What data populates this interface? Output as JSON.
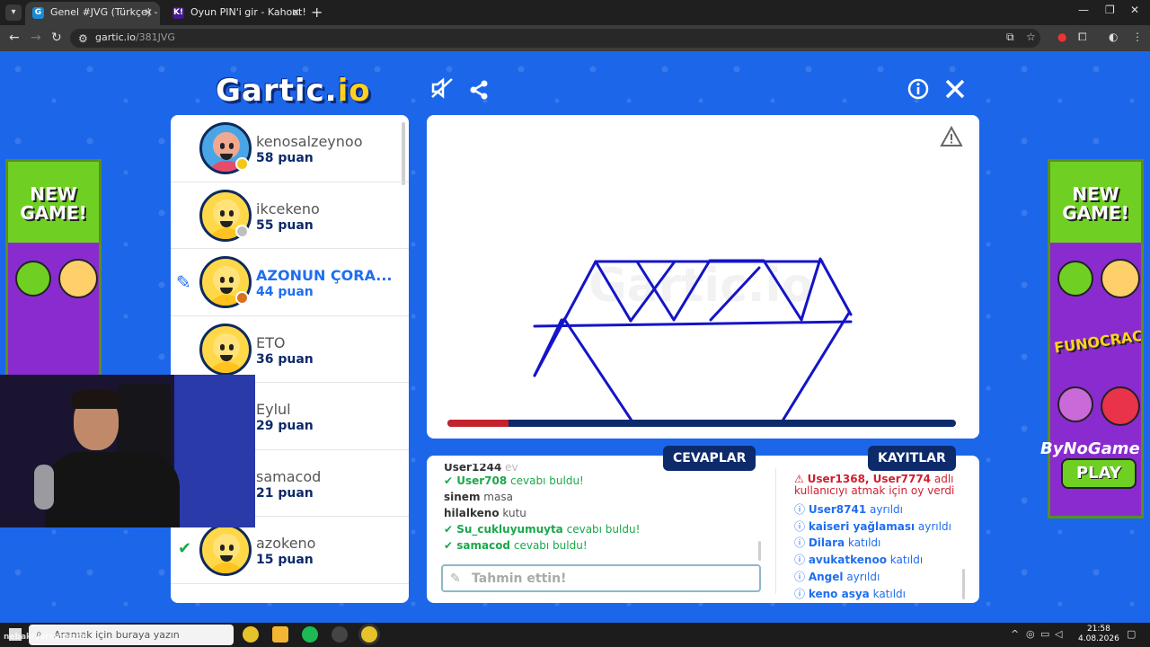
{
  "browser": {
    "tabs": [
      {
        "title": "Genel #JVG (Türkçe) - Gartic.io",
        "favicon": "G",
        "active": true
      },
      {
        "title": "Oyun PIN'i gir - Kahoot!",
        "favicon": "K!",
        "active": false
      }
    ],
    "url_domain": "gartic.io",
    "url_path": "/381JVG"
  },
  "game": {
    "logo_main": "Gartic.",
    "logo_io": "io",
    "players": [
      {
        "name": "kenosalzeynoo",
        "points": "58 puan",
        "avatar": "girl",
        "badge_color": "#f5c518",
        "state": "normal"
      },
      {
        "name": "ikcekeno",
        "points": "55 puan",
        "avatar": "default",
        "badge_color": "#bfbfbf",
        "state": "normal"
      },
      {
        "name": "AZONUN ÇORA...",
        "points": "44 puan",
        "avatar": "default",
        "badge_color": "#d9711f",
        "state": "drawing"
      },
      {
        "name": "ETO",
        "points": "36 puan",
        "avatar": "default",
        "badge_color": "",
        "state": "normal"
      },
      {
        "name": "Eylul",
        "points": "29 puan",
        "avatar": "default",
        "badge_color": "",
        "state": "normal"
      },
      {
        "name": "samacod",
        "points": "21 puan",
        "avatar": "default",
        "badge_color": "",
        "state": "guessed"
      },
      {
        "name": "azokeno",
        "points": "15 puan",
        "avatar": "default",
        "badge_color": "",
        "state": "guessed"
      }
    ],
    "canvas": {
      "watermark": "Gartic.io",
      "timer_progress": 0.12
    },
    "answers": {
      "tab_label": "CEVAPLAR",
      "lines": [
        {
          "user": "User1244",
          "text": "ev",
          "type": "faded"
        },
        {
          "user": "User708",
          "text": "cevabı buldu!",
          "type": "found"
        },
        {
          "user": "sinem",
          "text": "masa",
          "type": "guess"
        },
        {
          "user": "hilalkeno",
          "text": "kutu",
          "type": "guess"
        },
        {
          "user": "Su_cukluyumuyta",
          "text": "cevabı buldu!",
          "type": "found"
        },
        {
          "user": "samacod",
          "text": "cevabı buldu!",
          "type": "found"
        }
      ],
      "input_placeholder": "Tahmin ettin!"
    },
    "logs": {
      "tab_label": "KAYITLAR",
      "vote_users": "User1368, User7774",
      "vote_text": "adlı kullanıcıyı atmak için oy verdi",
      "lines": [
        {
          "user": "User8741",
          "action": "ayrıldı"
        },
        {
          "user": "kaiseri yağlaması",
          "action": "ayrıldı"
        },
        {
          "user": "Dilara",
          "action": "katıldı"
        },
        {
          "user": "avukatkenoo",
          "action": "katıldı"
        },
        {
          "user": "Angel",
          "action": "ayrıldı"
        },
        {
          "user": "keno asya",
          "action": "katıldı"
        }
      ]
    }
  },
  "ads": {
    "new_game": "NEW GAME!",
    "funocracy": "FUNOCRACY",
    "play": "PLAY",
    "sponsor": "ByNoGame"
  },
  "taskbar": {
    "search_placeholder": "Aramak için buraya yazın",
    "time": "21:58",
    "date": "4.08.2026",
    "overlay": "nebakiyorsunuzbe"
  }
}
